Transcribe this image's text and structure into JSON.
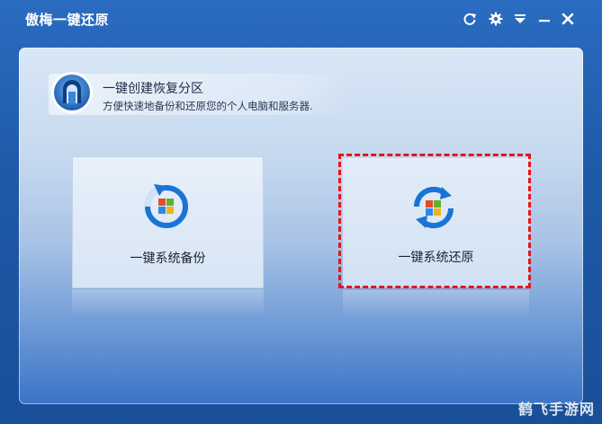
{
  "window": {
    "title": "傲梅一键还原"
  },
  "titlebar_buttons": [
    {
      "name": "refresh",
      "icon": "refresh-icon"
    },
    {
      "name": "settings",
      "icon": "gear-icon"
    },
    {
      "name": "menu",
      "icon": "menu-icon"
    },
    {
      "name": "minimize",
      "icon": "minimize-icon"
    },
    {
      "name": "close",
      "icon": "close-icon"
    }
  ],
  "info": {
    "title": "一键创建恢复分区",
    "subtitle": "方便快速地备份和还原您的个人电脑和服务器.",
    "icon": "partition-icon"
  },
  "cards": {
    "backup": {
      "label": "一键系统备份",
      "icon": "backup-icon"
    },
    "restore": {
      "label": "一键系统还原",
      "icon": "restore-icon"
    }
  },
  "watermark": "鹤飞手游网",
  "colors": {
    "titlebar": "#2a6cc1",
    "highlight": "#e8141c",
    "accent": "#1a74d6"
  }
}
